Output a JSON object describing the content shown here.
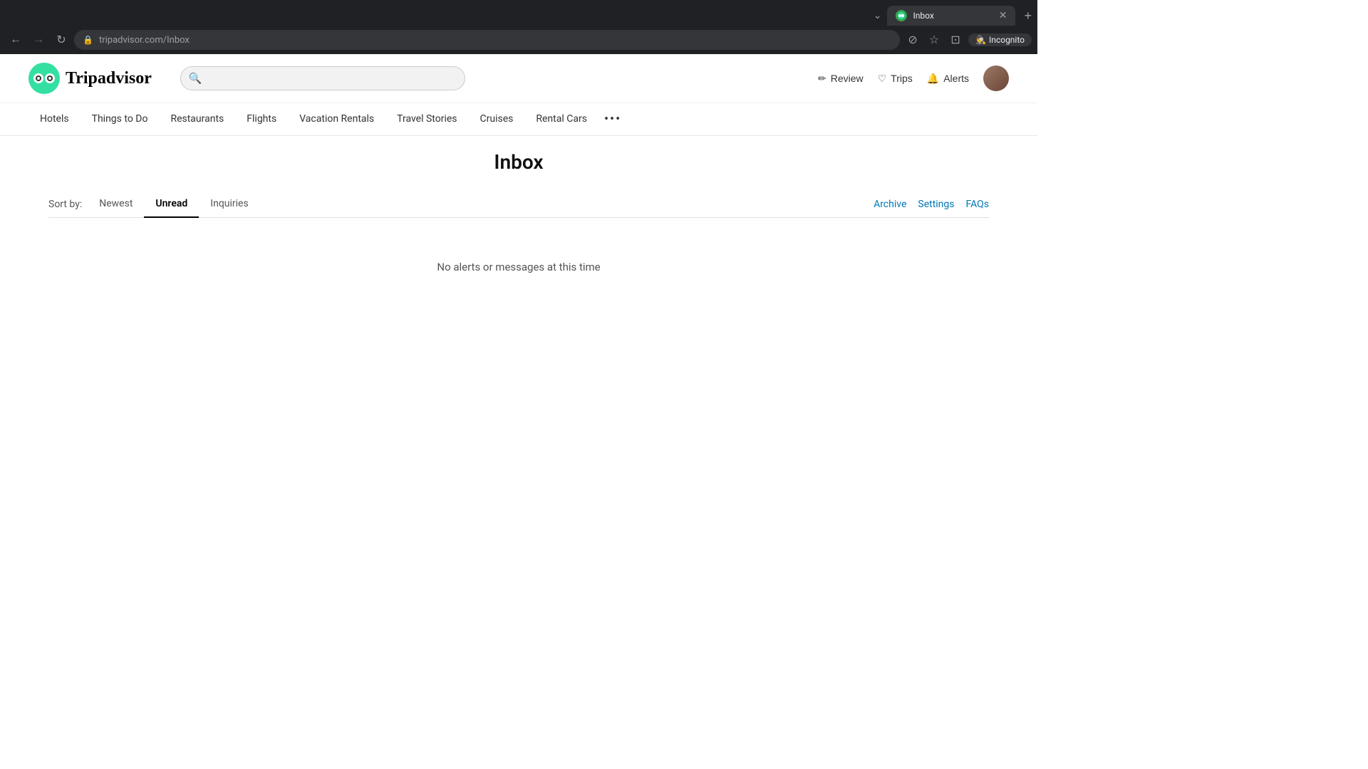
{
  "browser": {
    "tab": {
      "favicon_label": "T",
      "title": "Inbox",
      "close_icon": "✕",
      "new_tab_icon": "+"
    },
    "tab_list_icon": "⌄",
    "address": {
      "lock_icon": "🔒",
      "protocol": "",
      "domain": "tripadvisor.com",
      "path": "/Inbox"
    },
    "nav": {
      "back_icon": "←",
      "forward_icon": "→",
      "reload_icon": "↻"
    },
    "toolbar": {
      "security_icon": "⊘",
      "star_icon": "☆",
      "profile_icon": "⊡",
      "incognito_label": "Incognito",
      "incognito_icon": "🕵"
    }
  },
  "site": {
    "logo_icon": "●●",
    "logo_text": "Tripadvisor",
    "search_placeholder": "",
    "header_actions": {
      "review_label": "Review",
      "review_icon": "✏",
      "trips_label": "Trips",
      "trips_icon": "♡",
      "alerts_label": "Alerts",
      "alerts_icon": "🔔"
    },
    "nav_items": [
      {
        "label": "Hotels"
      },
      {
        "label": "Things to Do"
      },
      {
        "label": "Restaurants"
      },
      {
        "label": "Flights"
      },
      {
        "label": "Vacation Rentals"
      },
      {
        "label": "Travel Stories"
      },
      {
        "label": "Cruises"
      },
      {
        "label": "Rental Cars"
      }
    ],
    "nav_more": "•••"
  },
  "inbox": {
    "title": "Inbox",
    "sort_label": "Sort by:",
    "tabs": [
      {
        "label": "Newest",
        "active": false
      },
      {
        "label": "Unread",
        "active": true
      },
      {
        "label": "Inquiries",
        "active": false
      }
    ],
    "actions": [
      {
        "label": "Archive"
      },
      {
        "label": "Settings"
      },
      {
        "label": "FAQs"
      }
    ],
    "empty_message": "No alerts or messages at this time"
  }
}
